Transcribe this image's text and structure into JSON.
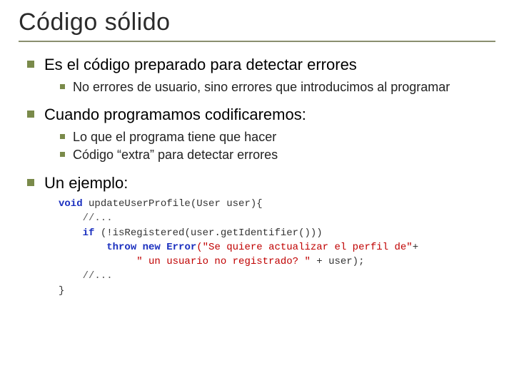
{
  "title": "Código sólido",
  "bullets": {
    "b1": "Es el código preparado para detectar errores",
    "b1_1": "No errores de usuario, sino errores que introducimos al programar",
    "b2": "Cuando programamos codificaremos:",
    "b2_1": "Lo que el programa tiene que hacer",
    "b2_2": "Código “extra” para detectar errores",
    "b3": "Un ejemplo:"
  },
  "code": {
    "kw_void": "void",
    "fn": " updateUserProfile(User user){",
    "c1": "    //...",
    "kw_if": "    if",
    "cond": " (!isRegistered(user.getIdentifier()))",
    "kw_throw": "        throw new ",
    "cls_error": "Error",
    "str_a": "(\"Se quiere actualizar el perfil de\"",
    "plus": "+",
    "str_b": "             \" un usuario no registrado? \"",
    "tail": " + user);",
    "c2": "    //...",
    "close": "}"
  }
}
